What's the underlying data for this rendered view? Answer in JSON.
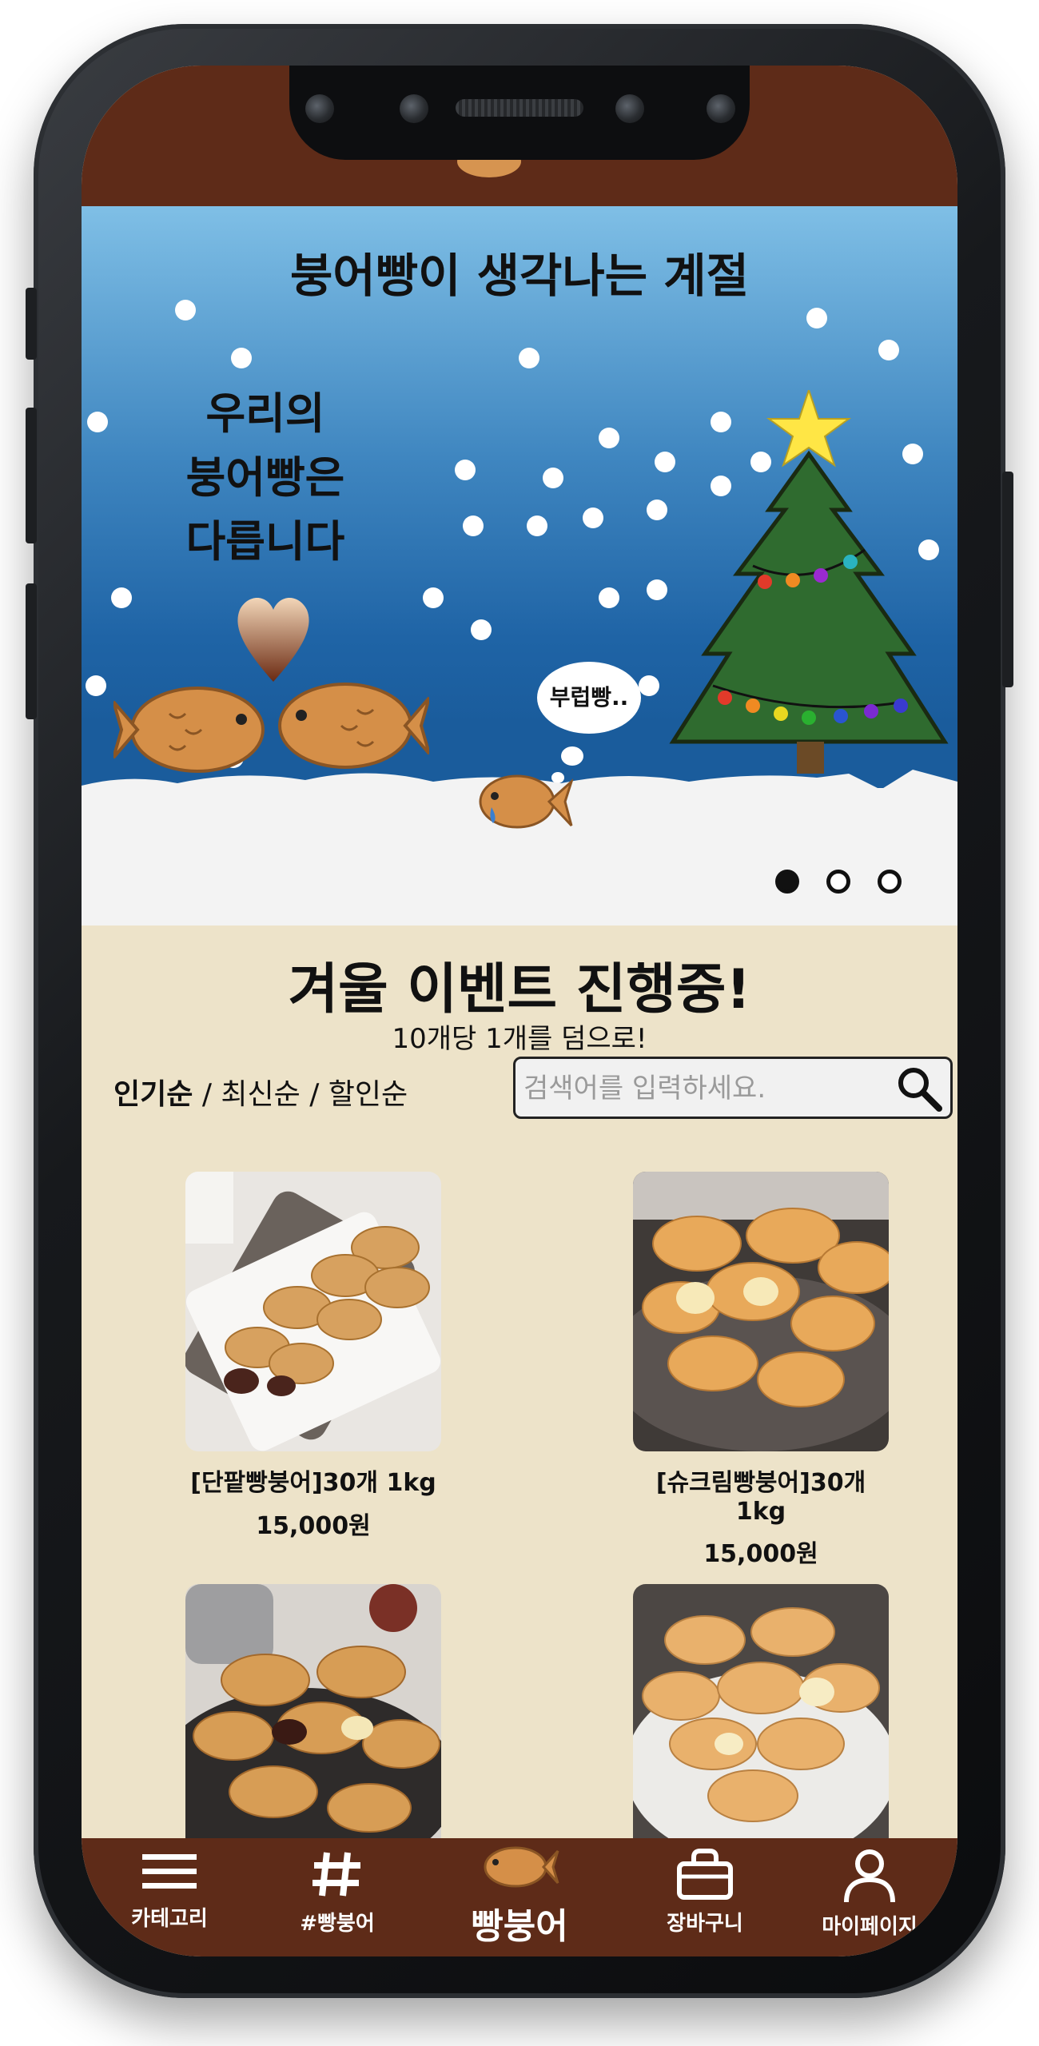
{
  "banner": {
    "title": "붕어빵이 생각나는 계절",
    "subtitle": "우리의\n붕어빵은\n다릅니다",
    "bubble_text": "부럽빵..",
    "slide_count": 3,
    "active_slide": 1
  },
  "event": {
    "title": "겨울 이벤트 진행중!",
    "subtitle": "10개당 1개를 덤으로!"
  },
  "sort": {
    "popular": "인기순",
    "separator": " / ",
    "newest": "최신순",
    "discount": "할인순"
  },
  "search": {
    "placeholder": "검색어를 입력하세요."
  },
  "products": [
    {
      "name": "[단팥빵붕어]30개 1kg",
      "price": "15,000원"
    },
    {
      "name": "[슈크림빵붕어]30개 1kg",
      "price": "15,000원"
    },
    {
      "name": "",
      "price": ""
    },
    {
      "name": "",
      "price": ""
    }
  ],
  "nav": {
    "category": "카테고리",
    "hashtag": "#빵붕어",
    "home": "빵붕어",
    "cart": "장바구니",
    "mypage": "마이페이지"
  },
  "colors": {
    "brand_brown": "#5e2b18",
    "background": "#ede3c9",
    "sky_blue": "#3f86c0"
  }
}
